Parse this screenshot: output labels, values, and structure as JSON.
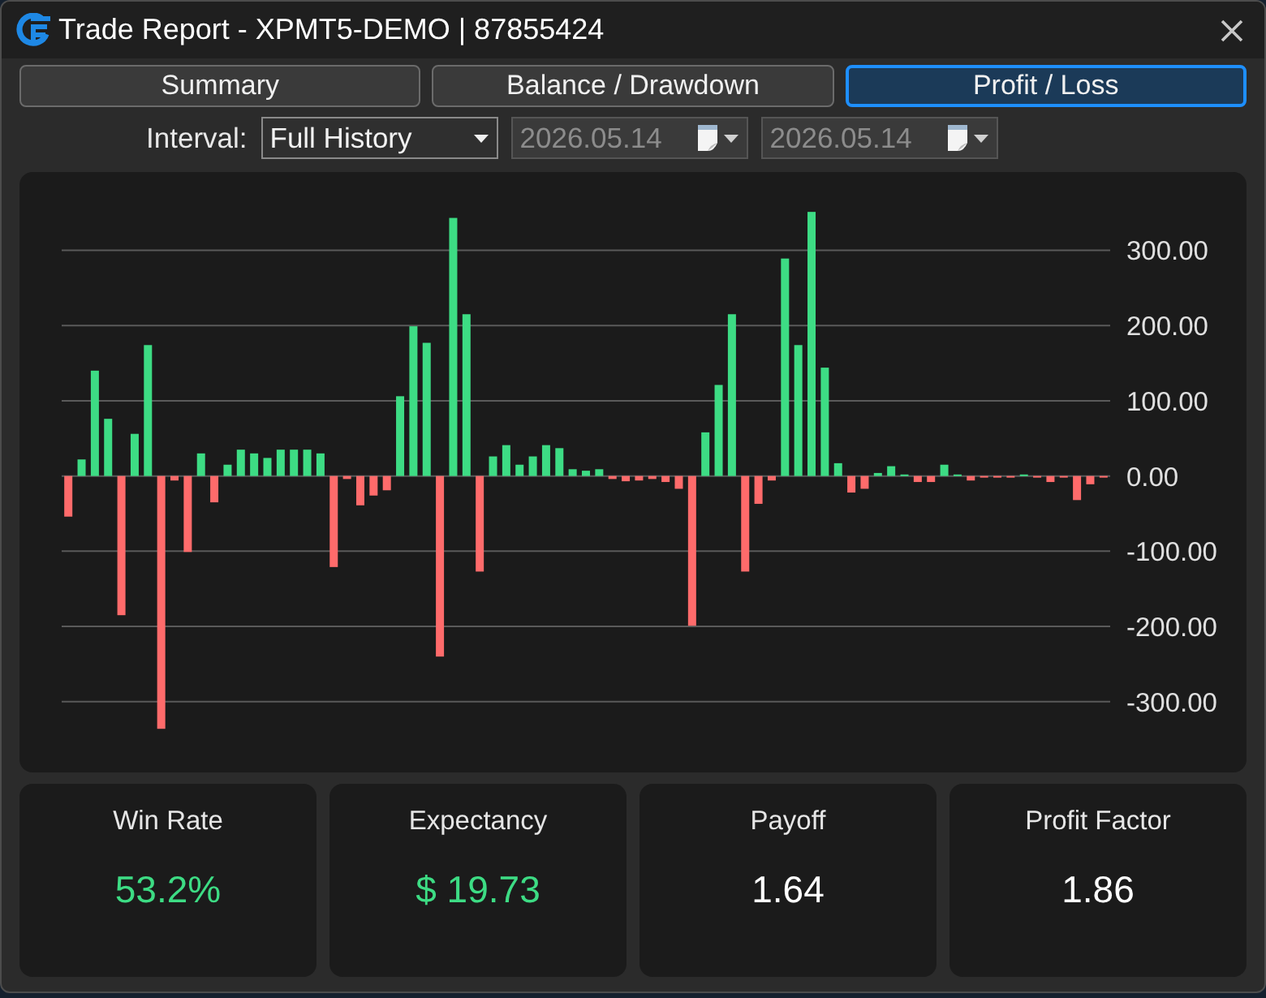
{
  "window": {
    "title": "Trade Report - XPMT5-DEMO | 87855424"
  },
  "tabs": [
    {
      "label": "Summary",
      "selected": false
    },
    {
      "label": "Balance / Drawdown",
      "selected": false
    },
    {
      "label": "Profit / Loss",
      "selected": true
    }
  ],
  "interval": {
    "label": "Interval:",
    "fields": [
      {
        "kind": "dropdown",
        "value": "Full History",
        "disabled": false
      },
      {
        "kind": "date",
        "value": "2026.05.14",
        "disabled": true
      },
      {
        "kind": "date",
        "value": "2026.05.14",
        "disabled": true
      }
    ]
  },
  "chart_panel": {
    "chart_data": {
      "type": "bar",
      "grid": true,
      "ylim": [
        -394,
        404
      ],
      "yticks": [
        {
          "value": 300,
          "label": "300.00"
        },
        {
          "value": 200,
          "label": "200.00"
        },
        {
          "value": 100,
          "label": "100.00"
        },
        {
          "value": 0,
          "label": "0.00"
        },
        {
          "value": -100,
          "label": "-100.00"
        },
        {
          "value": -200,
          "label": "-200.00"
        },
        {
          "value": -300,
          "label": "-300.00"
        }
      ],
      "series": [
        {
          "color": "#3ddc84",
          "values": [
            null,
            22,
            140,
            76,
            null,
            56,
            174,
            null,
            null,
            null,
            30,
            null,
            15,
            35,
            30,
            24,
            35,
            35,
            35,
            30,
            null,
            null,
            null,
            null,
            null,
            106,
            199,
            177,
            null,
            343,
            215,
            null,
            26,
            41,
            15,
            26,
            41,
            37,
            9,
            7,
            9,
            null,
            null,
            null,
            null,
            null,
            null,
            null,
            58,
            121,
            215,
            null,
            null,
            null,
            289,
            174,
            351,
            144,
            17,
            null,
            null,
            4,
            13,
            2,
            null,
            null,
            15,
            2,
            null,
            null,
            null,
            null,
            2,
            null,
            null,
            null,
            null,
            null,
            null
          ]
        },
        {
          "color": "#ff6b6b",
          "values": [
            -54,
            null,
            null,
            null,
            -185,
            null,
            null,
            -336,
            -6,
            -101,
            null,
            -35,
            null,
            null,
            null,
            null,
            null,
            null,
            null,
            null,
            -121,
            -4,
            -39,
            -26,
            -19,
            null,
            null,
            null,
            -240,
            null,
            null,
            -127,
            null,
            null,
            null,
            null,
            null,
            null,
            null,
            null,
            null,
            -4,
            -7,
            -6,
            -4,
            -8,
            -17,
            -199,
            null,
            null,
            null,
            -127,
            -37,
            -6,
            null,
            null,
            null,
            null,
            null,
            -22,
            -17,
            null,
            null,
            null,
            -8,
            -8,
            null,
            null,
            -6,
            -1,
            -1,
            -1,
            null,
            -1,
            -8,
            -1,
            -32,
            -11,
            -1
          ]
        }
      ]
    }
  },
  "stats": [
    {
      "label": "Win Rate",
      "value": "53.2%",
      "color": "#3ddc84"
    },
    {
      "label": "Expectancy",
      "value": "$ 19.73",
      "color": "#3ddc84"
    },
    {
      "label": "Payoff",
      "value": "1.64",
      "color": "#ffffff"
    },
    {
      "label": "Profit Factor",
      "value": "1.86",
      "color": "#ffffff"
    }
  ]
}
